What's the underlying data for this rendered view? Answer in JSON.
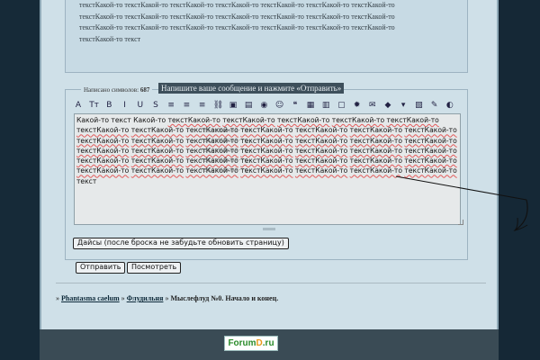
{
  "preview": {
    "lines": [
      "текстКакой-то текстКакой-то текстКакой-то текстКакой-то текстКакой-то текстКакой-то текстКакой-то",
      "текстКакой-то текстКакой-то текстКакой-то текстКакой-то текстКакой-то текстКакой-то текстКакой-то",
      "текстКакой-то текстКакой-то текстКакой-то текстКакой-то текстКакой-то текстКакой-то текстКакой-то",
      "текстКакой-то текст"
    ]
  },
  "compose": {
    "char_count_label": "Написано символов:",
    "char_count_value": "687",
    "hint": "Напишите ваше сообщение и нажмите «Отправить»",
    "toolbar": [
      {
        "icon": "font-icon",
        "glyph": "A"
      },
      {
        "icon": "font-size-icon",
        "glyph": "Tт"
      },
      {
        "icon": "bold-icon",
        "glyph": "B"
      },
      {
        "icon": "italic-icon",
        "glyph": "I"
      },
      {
        "icon": "underline-icon",
        "glyph": "U"
      },
      {
        "icon": "strikethrough-icon",
        "glyph": "S"
      },
      {
        "icon": "align-left-icon",
        "glyph": "≡"
      },
      {
        "icon": "align-center-icon",
        "glyph": "≡"
      },
      {
        "icon": "align-right-icon",
        "glyph": "≡"
      },
      {
        "icon": "link-icon",
        "glyph": "⛓"
      },
      {
        "icon": "image-icon",
        "glyph": "▣"
      },
      {
        "icon": "video-icon",
        "glyph": "▤"
      },
      {
        "icon": "media-icon",
        "glyph": "◉"
      },
      {
        "icon": "smiley-icon",
        "glyph": "☺"
      },
      {
        "icon": "quote-icon",
        "glyph": "❝"
      },
      {
        "icon": "code-icon",
        "glyph": "▦"
      },
      {
        "icon": "table-icon",
        "glyph": "▥"
      },
      {
        "icon": "spoiler-icon",
        "glyph": "▢"
      },
      {
        "icon": "hide-icon",
        "glyph": "✹"
      },
      {
        "icon": "mail-icon",
        "glyph": "✉"
      },
      {
        "icon": "color-icon",
        "glyph": "◆"
      },
      {
        "icon": "more-icon",
        "glyph": "▾"
      },
      {
        "icon": "upload-icon",
        "glyph": "▧"
      },
      {
        "icon": "edit-icon",
        "glyph": "✎"
      },
      {
        "icon": "clear-icon",
        "glyph": "◐"
      }
    ],
    "text_lines": [
      [
        "Какой-то текст Какой-то ",
        "текстКакой-то",
        " ",
        "текстКакой-то",
        " ",
        "текстКакой-то",
        " ",
        "текстКакой-то",
        " ",
        "текстКакой-то"
      ],
      [
        "текстКакой-то",
        " ",
        "текстКакой-то",
        " ",
        "текстКакой-то",
        " ",
        "текстКакой-то",
        " ",
        "текстКакой-то",
        " ",
        "текстКакой-то",
        " ",
        "текстКакой-то"
      ],
      [
        "текстКакой-то",
        " ",
        "текстКакой-то",
        " ",
        "текстКакой-то",
        " ",
        "текстКакой-то",
        " ",
        "текстКакой-то",
        " ",
        "текстКакой-то",
        " ",
        "текстКакой-то"
      ],
      [
        "текстКакой-то",
        " ",
        "текстКакой-то",
        " ",
        "текстКакой-то",
        " ",
        "текстКакой-то",
        " ",
        "текстКакой-то",
        " ",
        "текстКакой-то",
        " ",
        "текстКакой-то"
      ],
      [
        "текстКакой-то",
        " ",
        "текстКакой-то",
        " ",
        "текстКакой-то",
        " ",
        "текстКакой-то",
        " ",
        "текстКакой-то",
        " ",
        "текстКакой-то",
        " ",
        "текстКакой-то"
      ],
      [
        "текстКакой-то",
        " ",
        "текстКакой-то",
        " ",
        "текстКакой-то",
        " ",
        "текстКакой-то",
        " ",
        "текстКакой-то",
        " ",
        "текстКакой-то",
        " ",
        "текстКакой-то"
      ],
      [
        "текст"
      ]
    ],
    "dice_button": "Дайсы (после броска не забудьте обновить страницу)",
    "send_button": "Отправить",
    "preview_button": "Посмотреть"
  },
  "breadcrumb": {
    "prefix": "»",
    "forum": "Phantasma caelum",
    "sep1": "»",
    "section": "Флудильня",
    "sep2": "»",
    "topic": "Мыслефлуд №0. Начало и конец."
  },
  "footer": {
    "logo_main": "Forum",
    "logo_dot": "D",
    "logo_tld": ".ru"
  }
}
